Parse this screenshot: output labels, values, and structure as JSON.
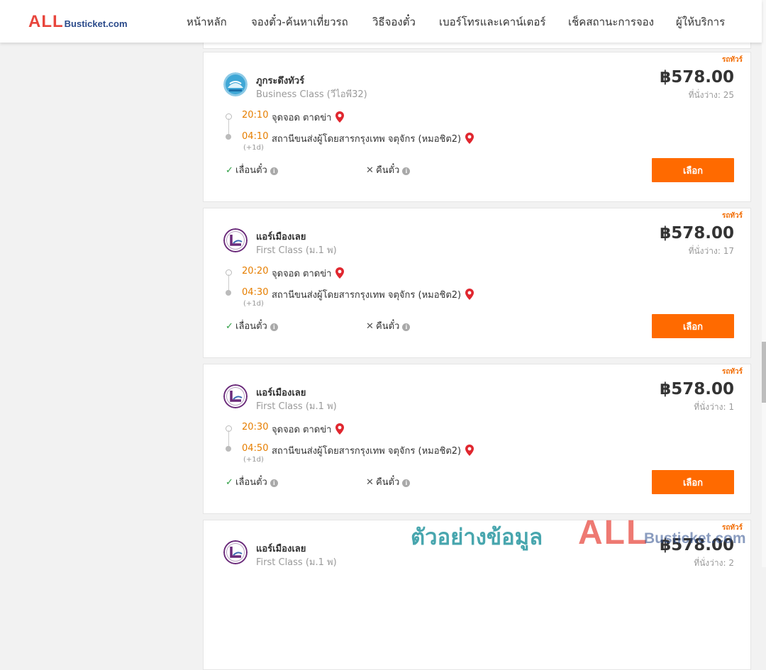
{
  "brand": {
    "logo_main": "ALL",
    "logo_sub": "Busticket.com"
  },
  "nav": [
    "หน้าหลัก",
    "จองตั๋ว-ค้นหาเที่ยวรถ",
    "วิธีจองตั๋ว",
    "เบอร์โทรและเคาน์เตอร์",
    "เช็คสถานะการจอง",
    "ผู้ให้บริการ"
  ],
  "colors": {
    "accent": "#ff6a00",
    "time": "#e67e00",
    "logo_red": "#e8453c",
    "logo_blue": "#2a4a8a"
  },
  "results": [
    {
      "tag": "รถทัวร์",
      "operator": "ภูกระดึงทัวร์",
      "logo_icon": "phukradueng-tour-logo",
      "bus_class": "Business Class (วีไอพี32)",
      "price": "฿578.00",
      "seats": "ที่นั่งว่าง: 25",
      "depart_time": "20:10",
      "depart_place": "จุดจอด ตาดข่า",
      "arrive_time": "04:10",
      "arrive_place": "สถานีขนส่งผู้โดยสารกรุงเทพ จตุจักร (หมอชิต2)",
      "day_offset": "(+1d)",
      "reschedule": "เลื่อนตั๋ว",
      "refund": "คืนตั๋ว",
      "button": "เลือก"
    },
    {
      "tag": "รถทัวร์",
      "operator": "แอร์เมืองเลย",
      "logo_icon": "air-mueang-loei-logo",
      "bus_class": "First Class (ม.1 พ)",
      "price": "฿578.00",
      "seats": "ที่นั่งว่าง: 17",
      "depart_time": "20:20",
      "depart_place": "จุดจอด ตาดข่า",
      "arrive_time": "04:30",
      "arrive_place": "สถานีขนส่งผู้โดยสารกรุงเทพ จตุจักร (หมอชิต2)",
      "day_offset": "(+1d)",
      "reschedule": "เลื่อนตั๋ว",
      "refund": "คืนตั๋ว",
      "button": "เลือก"
    },
    {
      "tag": "รถทัวร์",
      "operator": "แอร์เมืองเลย",
      "logo_icon": "air-mueang-loei-logo",
      "bus_class": "First Class (ม.1 พ)",
      "price": "฿578.00",
      "seats": "ที่นั่งว่าง: 1",
      "depart_time": "20:30",
      "depart_place": "จุดจอด ตาดข่า",
      "arrive_time": "04:50",
      "arrive_place": "สถานีขนส่งผู้โดยสารกรุงเทพ จตุจักร (หมอชิต2)",
      "day_offset": "(+1d)",
      "reschedule": "เลื่อนตั๋ว",
      "refund": "คืนตั๋ว",
      "button": "เลือก"
    },
    {
      "tag": "รถทัวร์",
      "operator": "แอร์เมืองเลย",
      "logo_icon": "air-mueang-loei-logo",
      "bus_class": "First Class (ม.1 พ)",
      "price": "฿578.00",
      "seats": "ที่นั่งว่าง: 2"
    }
  ],
  "watermark": {
    "text": "ตัวอย่างข้อมูล",
    "logo_main": "ALL",
    "logo_sub": "Busticket.com"
  }
}
